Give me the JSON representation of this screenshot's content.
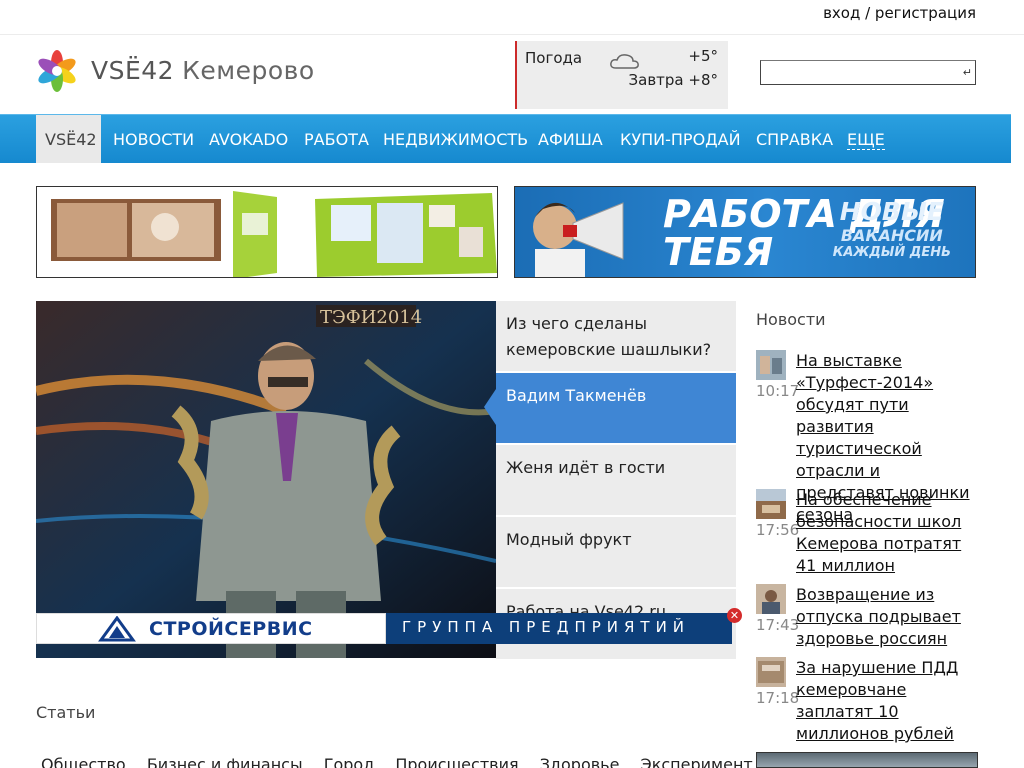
{
  "header": {
    "login_text": "вход / регистрация",
    "brand": "VSЁ42",
    "city": "Кемерово",
    "weather_label": "Погода",
    "weather_now": "+5°",
    "weather_tomorrow": "Завтра +8°",
    "search_placeholder": ""
  },
  "nav": {
    "items": [
      "VSЁ42",
      "НОВОСТИ",
      "AVOKADO",
      "РАБОТА",
      "НЕДВИЖИМОСТЬ",
      "АФИША",
      "КУПИ-ПРОДАЙ",
      "СПРАВКА",
      "ЕЩЕ"
    ]
  },
  "banners": {
    "right_main": "РАБОТА ДЛЯ ТЕБЯ",
    "right_side_a": "НОВЫЕ",
    "right_side_b": "ВАКАНСИИ",
    "right_side_c": "КАЖДЫЙ ДЕНЬ"
  },
  "hero": {
    "sign": "ТЭФИ2014"
  },
  "tabs": [
    "Из чего сделаны кемеровские шашлыки?",
    "Вадим Такменёв",
    "Женя идёт в гости",
    "Модный фрукт",
    "Работа на Vse42.ru"
  ],
  "ad_strip": {
    "left": "СТРОЙСЕРВИС",
    "right": "ГРУППА ПРЕДПРИЯТИЙ"
  },
  "news": {
    "heading": "Новости",
    "items": [
      {
        "time": "10:17",
        "title": "На выставке «Турфест-2014» обсудят пути развития туристической отрасли и представят новинки сезона"
      },
      {
        "time": "17:56",
        "title": "На обеспечение безопасности школ Кемерова потратят 41 миллион"
      },
      {
        "time": "17:43",
        "title": "Возвращение из отпуска подрывает здоровье россиян"
      },
      {
        "time": "17:18",
        "title": "За нарушение ПДД кемеровчане заплатят 10 миллионов рублей"
      }
    ]
  },
  "articles": {
    "heading": "Статьи",
    "categories": [
      "Общество",
      "Бизнес и финансы",
      "Город",
      "Происшествия",
      "Здоровье",
      "Эксперимент"
    ]
  }
}
